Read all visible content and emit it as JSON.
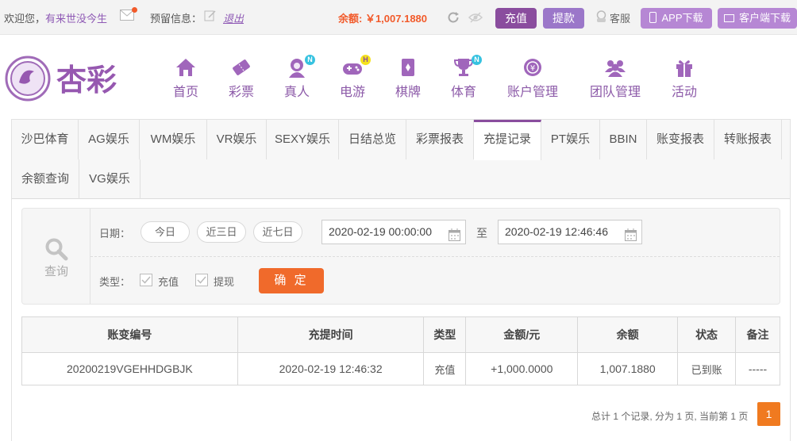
{
  "topbar": {
    "welcome_prefix": "欢迎您，",
    "username": "有来世没今生",
    "reserve_label": "预留信息：",
    "logout_label": "退出",
    "balance": "余额: ￥1,007.1880",
    "deposit_label": "充值",
    "withdraw_label": "提款",
    "service_label": "客服",
    "app_download_label": "APP下载",
    "client_download_label": "客户端下载"
  },
  "colors": {
    "brand": "#8a4d9e",
    "accent": "#f06a2b",
    "balance": "#f25a2a",
    "amount_positive": "#d9222a",
    "status_ok": "#4fa325"
  },
  "logo": {
    "text": "杏彩"
  },
  "nav": [
    {
      "label": "首页",
      "icon": "home-icon"
    },
    {
      "label": "彩票",
      "icon": "lottery-icon"
    },
    {
      "label": "真人",
      "icon": "live-dealer-icon",
      "badge": "N"
    },
    {
      "label": "电游",
      "icon": "gamepad-icon",
      "badge": "H"
    },
    {
      "label": "棋牌",
      "icon": "cards-icon"
    },
    {
      "label": "体育",
      "icon": "trophy-icon",
      "badge": "N"
    },
    {
      "label": "账户管理",
      "icon": "account-icon"
    },
    {
      "label": "团队管理",
      "icon": "team-icon"
    },
    {
      "label": "活动",
      "icon": "gift-icon"
    }
  ],
  "tabs": [
    {
      "label": "沙巴体育"
    },
    {
      "label": "AG娱乐"
    },
    {
      "label": "WM娱乐"
    },
    {
      "label": "VR娱乐"
    },
    {
      "label": "SEXY娱乐"
    },
    {
      "label": "日结总览"
    },
    {
      "label": "彩票报表"
    },
    {
      "label": "充提记录",
      "active": true
    },
    {
      "label": "PT娱乐"
    },
    {
      "label": "BBIN"
    },
    {
      "label": "账变报表"
    },
    {
      "label": "转账报表"
    },
    {
      "label": "余额查询"
    },
    {
      "label": "VG娱乐"
    }
  ],
  "query": {
    "title": "查询",
    "date_label": "日期：",
    "quick_ranges": [
      "今日",
      "近三日",
      "近七日"
    ],
    "start_date": "2020-02-19 00:00:00",
    "to_label": "至",
    "end_date": "2020-02-19 12:46:46",
    "type_label": "类型：",
    "type_options": [
      "充值",
      "提现"
    ],
    "confirm_label": "确 定"
  },
  "table": {
    "headers": [
      "账变编号",
      "充提时间",
      "类型",
      "金额/元",
      "余额",
      "状态",
      "备注"
    ],
    "rows": [
      [
        "20200219VGEHHDGBJK",
        "2020-02-19 12:46:32",
        "充值",
        "+1,000.0000",
        "1,007.1880",
        "已到账",
        "-----"
      ]
    ]
  },
  "pagination": {
    "summary": "总计 1 个记录, 分为 1 页, 当前第 1 页",
    "current_page": "1"
  }
}
